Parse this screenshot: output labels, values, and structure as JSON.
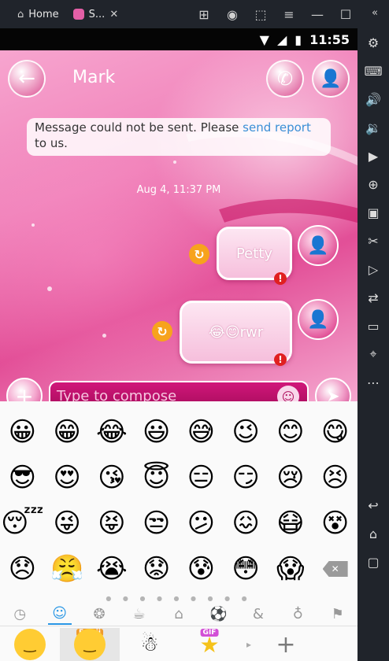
{
  "emulator": {
    "home_tab": "Home",
    "app_tab": "S..."
  },
  "status": {
    "time": "11:55"
  },
  "header": {
    "contact_name": "Mark"
  },
  "chat": {
    "error_message": "Message could not be sent. Please ",
    "error_link": "send report",
    "error_tail": " to us.",
    "timestamp": "Aug 4, 11:37 PM",
    "messages": [
      {
        "text": "Petty",
        "retry": "↻",
        "error": "!"
      },
      {
        "text": "😂😊rwr",
        "retry": "↻",
        "error": "!"
      }
    ]
  },
  "compose": {
    "placeholder": "Type to compose"
  },
  "keyboard": {
    "emoji_rows": [
      [
        "😀",
        "😁",
        "😂",
        "😃",
        "😅",
        "😉",
        "😊",
        "😋"
      ],
      [
        "😎",
        "😍",
        "😘",
        "😇",
        "😑",
        "😏",
        "😢",
        "😣"
      ],
      [
        "😴",
        "😜",
        "😝",
        "😒",
        "😕",
        "😖",
        "😷",
        "😵"
      ],
      [
        "😞",
        "😤",
        "😭",
        "😟",
        "😰",
        "😳",
        "😱",
        "⌫"
      ]
    ],
    "pager": "● ● ● ● ● ● ● ● ●",
    "category_icons": [
      "clock-icon",
      "smiley-icon",
      "animal-icon",
      "food-icon",
      "travel-icon",
      "sports-icon",
      "symbols-icon",
      "objects-icon",
      "flag-icon"
    ],
    "bottom_tabs": [
      {
        "label": ""
      },
      {
        "label": "Emoji"
      },
      {
        "label": ""
      },
      {
        "label": "GIF"
      }
    ],
    "add_label": "+"
  }
}
